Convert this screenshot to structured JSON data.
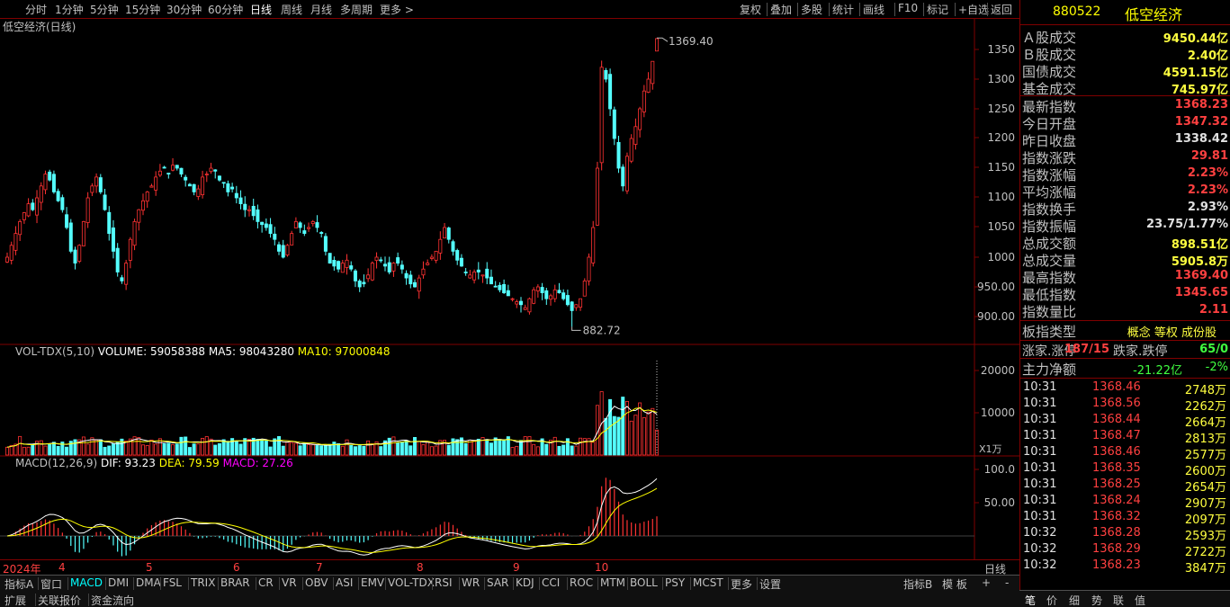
{
  "periods": [
    {
      "label": "分时"
    },
    {
      "label": "1分钟"
    },
    {
      "label": "5分钟"
    },
    {
      "label": "15分钟"
    },
    {
      "label": "30分钟"
    },
    {
      "label": "60分钟"
    },
    {
      "label": "日线",
      "active": true
    },
    {
      "label": "周线"
    },
    {
      "label": "月线"
    },
    {
      "label": "多周期"
    },
    {
      "label": "更多 >"
    }
  ],
  "toolbar": [
    "复权",
    "叠加",
    "多股",
    "统计",
    "画线",
    "F10",
    "标记",
    "+自选",
    "返回"
  ],
  "chart": {
    "main_title": "低空经济(日线)",
    "high_label": "1369.40",
    "low_label": "882.72",
    "price_ticks": [
      "1350",
      "1300",
      "1250",
      "1200",
      "1150",
      "1100",
      "1050",
      "1000",
      "950.00",
      "900.00"
    ],
    "vol_title": "VOL-TDX(5,10)",
    "vol_value": "VOLUME: 59058388",
    "ma5": "MA5: 98043280",
    "ma10": "MA10: 97000848",
    "vol_ticks": [
      "20000",
      "10000"
    ],
    "vol_unit": "X1万",
    "macd_title": "MACD(12,26,9)",
    "dif": "DIF: 93.23",
    "dea": "DEA: 79.59",
    "macd": "MACD: 27.26",
    "macd_ticks": [
      "100.0",
      "50.00"
    ],
    "x_labels": [
      "2024年",
      "4",
      "5",
      "6",
      "7",
      "8",
      "9",
      "10"
    ],
    "x_right": "日线"
  },
  "chart_data": {
    "type": "candlestick",
    "title": "低空经济(日线)",
    "high": 1369.4,
    "low": 882.72,
    "close_last": 1368.23,
    "months": [
      "2024年",
      "4",
      "5",
      "6",
      "7",
      "8",
      "9",
      "10"
    ],
    "closes": [
      1000,
      1020,
      1040,
      1060,
      1075,
      1090,
      1080,
      1100,
      1120,
      1140,
      1130,
      1110,
      1095,
      1080,
      1050,
      1010,
      990,
      1020,
      1060,
      1100,
      1120,
      1135,
      1110,
      1080,
      1040,
      1010,
      975,
      960,
      990,
      1030,
      1060,
      1080,
      1095,
      1110,
      1120,
      1135,
      1145,
      1150,
      1140,
      1155,
      1150,
      1140,
      1130,
      1120,
      1110,
      1115,
      1135,
      1140,
      1150,
      1145,
      1130,
      1125,
      1110,
      1115,
      1100,
      1090,
      1080,
      1080,
      1070,
      1060,
      1055,
      1050,
      1040,
      1030,
      1010,
      1000,
      1020,
      1040,
      1060,
      1050,
      1040,
      1050,
      1060,
      1050,
      1040,
      1010,
      990,
      985,
      980,
      990,
      995,
      980,
      960,
      950,
      955,
      970,
      990,
      1000,
      995,
      985,
      975,
      990,
      990,
      980,
      965,
      955,
      950,
      965,
      980,
      990,
      1000,
      1010,
      1030,
      1050,
      1030,
      1010,
      995,
      985,
      975,
      970,
      975,
      975,
      970,
      965,
      955,
      950,
      945,
      940,
      935,
      930,
      925,
      920,
      915,
      930,
      945,
      950,
      940,
      930,
      935,
      945,
      940,
      930,
      920,
      910,
      920,
      930,
      960,
      1000,
      1050,
      1150,
      1320,
      1300,
      1250,
      1200,
      1150,
      1120,
      1170,
      1200,
      1220,
      1250,
      1280,
      1300,
      1330,
      1368.23
    ],
    "volume_ma5": 98043280,
    "volume_ma10": 97000848,
    "volume_last": 59058388,
    "macd": {
      "dif": 93.23,
      "dea": 79.59,
      "macd": 27.26
    },
    "ylim": [
      880,
      1380
    ]
  },
  "panel": {
    "code": "880522",
    "name": "低空经济",
    "stats": [
      {
        "label": "Ａ股成交",
        "value": "9450.44亿",
        "color": "#ffff40"
      },
      {
        "label": "Ｂ股成交",
        "value": "2.40亿",
        "color": "#ffff40"
      },
      {
        "label": "国债成交",
        "value": "4591.15亿",
        "color": "#ffff40"
      },
      {
        "label": "基金成交",
        "value": "745.97亿",
        "color": "#ffff40"
      },
      {
        "label": "最新指数",
        "value": "1368.23",
        "color": "#ff4040"
      },
      {
        "label": "今日开盘",
        "value": "1347.32",
        "color": "#ff4040"
      },
      {
        "label": "昨日收盘",
        "value": "1338.42",
        "color": "#e0e0e0"
      },
      {
        "label": "指数涨跌",
        "value": "29.81",
        "color": "#ff4040"
      },
      {
        "label": "指数涨幅",
        "value": "2.23%",
        "color": "#ff4040"
      },
      {
        "label": "平均涨幅",
        "value": "2.23%",
        "color": "#ff4040"
      },
      {
        "label": "指数换手",
        "value": "2.93%",
        "color": "#e0e0e0"
      },
      {
        "label": "指数振幅",
        "value": "23.75/1.77%",
        "color": "#e0e0e0"
      },
      {
        "label": "总成交额",
        "value": "898.51亿",
        "color": "#ffff40"
      },
      {
        "label": "总成交量",
        "value": "5905.8万",
        "color": "#ffff40"
      },
      {
        "label": "最高指数",
        "value": "1369.40",
        "color": "#ff4040"
      },
      {
        "label": "最低指数",
        "value": "1345.65",
        "color": "#ff4040"
      },
      {
        "label": "指数量比",
        "value": "2.11",
        "color": "#ff4040"
      }
    ],
    "type_label": "板指类型",
    "type_value": "概念 等权 成份股",
    "updown_label1": "涨家.涨停",
    "updown_val1": "187/15",
    "updown_label2": "跌家.跌停",
    "updown_val2": "65/0",
    "main_label": "主力净额",
    "main_val": "-21.22亿",
    "main_pct": "-2%",
    "ticks": [
      {
        "t": "10:31",
        "p": "1368.46",
        "v": "2748万"
      },
      {
        "t": "10:31",
        "p": "1368.56",
        "v": "2262万"
      },
      {
        "t": "10:31",
        "p": "1368.44",
        "v": "2664万"
      },
      {
        "t": "10:31",
        "p": "1368.47",
        "v": "2813万"
      },
      {
        "t": "10:31",
        "p": "1368.46",
        "v": "2577万"
      },
      {
        "t": "10:31",
        "p": "1368.35",
        "v": "2600万"
      },
      {
        "t": "10:31",
        "p": "1368.25",
        "v": "2654万"
      },
      {
        "t": "10:31",
        "p": "1368.24",
        "v": "2907万"
      },
      {
        "t": "10:31",
        "p": "1368.32",
        "v": "2097万"
      },
      {
        "t": "10:32",
        "p": "1368.28",
        "v": "2593万"
      },
      {
        "t": "10:32",
        "p": "1368.29",
        "v": "2722万"
      },
      {
        "t": "10:32",
        "p": "1368.23",
        "v": "3847万"
      }
    ],
    "rtabs": [
      "笔",
      "价",
      "细",
      "势",
      "联",
      "值"
    ]
  },
  "tabs1": [
    "指标A",
    "窗口",
    "MACD",
    "DMI",
    "DMA",
    "FSL",
    "TRIX",
    "BRAR",
    "CR",
    "VR",
    "OBV",
    "ASI",
    "EMV",
    "VOL-TDX",
    "RSI",
    "WR",
    "SAR",
    "KDJ",
    "CCI",
    "ROC",
    "MTM",
    "BOLL",
    "PSY",
    "MCST",
    "更多",
    "设置"
  ],
  "tabs1_right": [
    "指标B",
    "模 板",
    "+",
    "-"
  ],
  "tabs2": [
    "扩展",
    "关联报价",
    "资金流向"
  ],
  "colors": {
    "up": "#ff3232",
    "down": "#54ffff",
    "ma5": "#ffffff",
    "ma10": "#ffff00",
    "grid": "#800000"
  }
}
